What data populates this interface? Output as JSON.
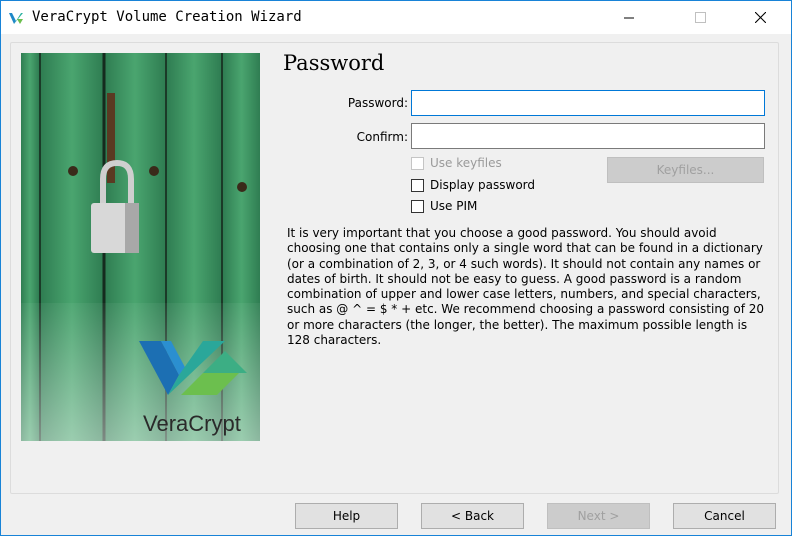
{
  "window": {
    "title": "VeraCrypt Volume Creation Wizard",
    "controls": {
      "minimize": "minimize",
      "maximize": "maximize",
      "close": "close"
    }
  },
  "side_image": {
    "logo_text": "VeraCrypt",
    "icon": "padlock-on-green-door"
  },
  "page": {
    "title": "Password",
    "password_label": "Password:",
    "password_value": "",
    "confirm_label": "Confirm:",
    "confirm_value": "",
    "use_keyfiles_label": "Use keyfiles",
    "use_keyfiles_checked": false,
    "use_keyfiles_enabled": false,
    "keyfiles_button": "Keyfiles...",
    "display_password_label": "Display password",
    "display_password_checked": false,
    "use_pim_label": "Use PIM",
    "use_pim_checked": false,
    "info": "It is very important that you choose a good password. You should avoid choosing one that contains only a single word that can be found in a dictionary (or a combination of 2, 3, or 4 such words). It should not contain any names or dates of birth. It should not be easy to guess. A good password is a random combination of upper and lower case letters, numbers, and special characters, such as @ ^ = $ * + etc. We recommend choosing a password consisting of 20 or more characters (the longer, the better). The maximum possible length is 128 characters."
  },
  "footer": {
    "help": "Help",
    "back": "< Back",
    "next": "Next >",
    "cancel": "Cancel"
  },
  "colors": {
    "accent": "#0078d7",
    "window_border": "#1883d7",
    "door_green": "#3d9462",
    "background": "#f0f0f0"
  }
}
